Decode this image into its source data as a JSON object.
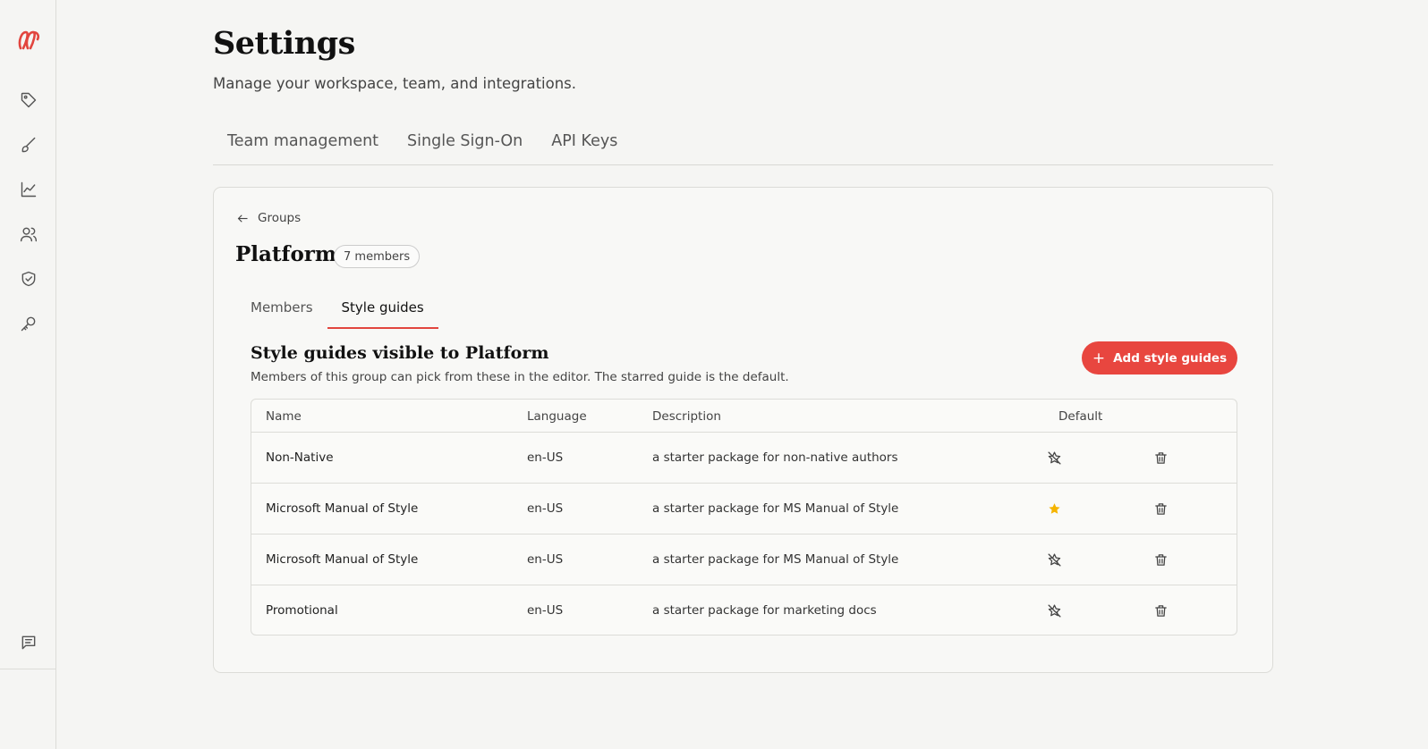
{
  "header": {
    "title": "Settings",
    "subtitle": "Manage your workspace, team, and integrations."
  },
  "tabs": [
    "Team management",
    "Single Sign-On",
    "API Keys"
  ],
  "sidebar": {
    "icons": [
      "tag-icon",
      "brush-icon",
      "chart-icon",
      "users-icon",
      "shield-icon",
      "key-icon",
      "chat-icon"
    ]
  },
  "group": {
    "back_label": "Groups",
    "name": "Platform",
    "member_count": "7 members",
    "tabs": [
      "Members",
      "Style guides"
    ],
    "active_tab": "Style guides"
  },
  "section": {
    "title": "Style guides visible to Platform",
    "subtitle": "Members of this group can pick from these in the editor. The starred guide is the default.",
    "add_button": "Add style guides"
  },
  "table": {
    "columns": [
      "Name",
      "Language",
      "Description",
      "Default"
    ],
    "rows": [
      {
        "name": "Non-Native",
        "language": "en-US",
        "description": "a starter package for non-native authors",
        "default": false
      },
      {
        "name": "Microsoft Manual of Style",
        "language": "en-US",
        "description": "a starter package for MS Manual of Style",
        "default": true
      },
      {
        "name": "Microsoft Manual of Style",
        "language": "en-US",
        "description": "a starter package for MS Manual of Style",
        "default": false
      },
      {
        "name": "Promotional",
        "language": "en-US",
        "description": "a starter package for marketing docs",
        "default": false
      }
    ]
  },
  "colors": {
    "accent": "#e8463f",
    "star": "#f5b400",
    "background": "#f5f5f3"
  }
}
